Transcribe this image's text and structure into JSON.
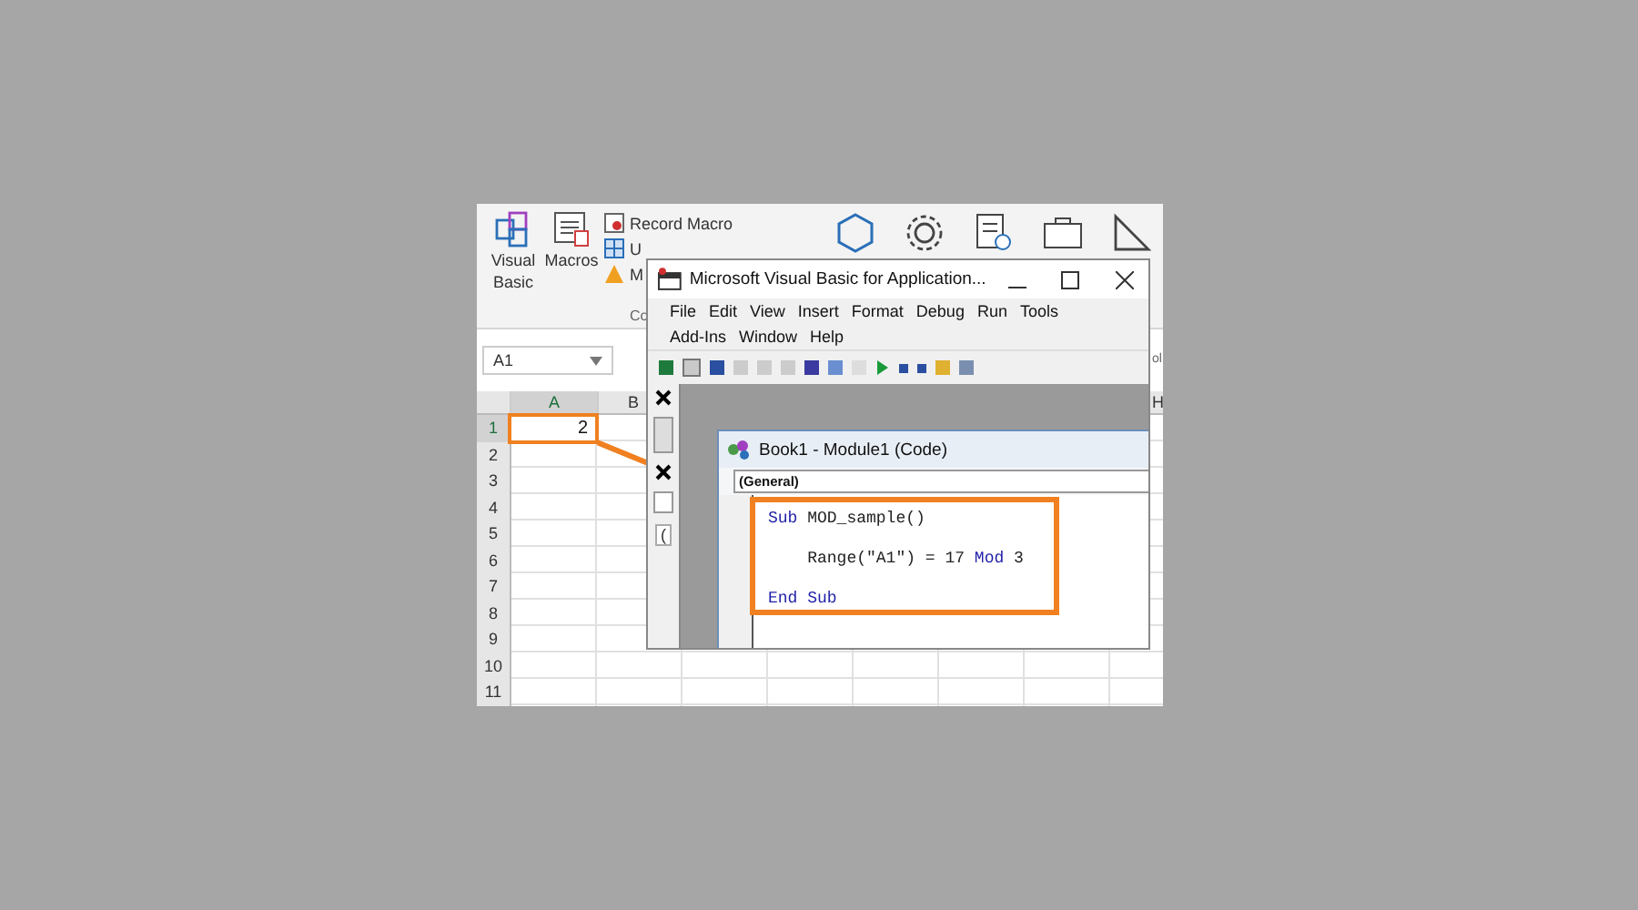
{
  "ribbon": {
    "buttons": [
      {
        "label": "Visual Basic",
        "kind": "vb"
      },
      {
        "label": "Macros",
        "kind": "macros"
      }
    ],
    "small_commands": [
      "Record Macro",
      "U",
      "M"
    ],
    "group_label": "Co",
    "right_label": "ol"
  },
  "name_box": {
    "value": "A1"
  },
  "sheet": {
    "columns": [
      "A",
      "B",
      "H"
    ],
    "rows": [
      "1",
      "2",
      "3",
      "4",
      "5",
      "6",
      "7",
      "8",
      "9",
      "10",
      "11"
    ],
    "cell_a1": "2"
  },
  "vba_window": {
    "title": "Microsoft Visual Basic for Application...",
    "menu_rows": [
      [
        "File",
        "Edit",
        "View",
        "Insert",
        "Format",
        "Debug",
        "Run",
        "Tools"
      ],
      [
        "Add-Ins",
        "Window",
        "Help"
      ]
    ],
    "side_text": "(",
    "code_window": {
      "title": "Book1 - Module1 (Code)",
      "object_combo": "(General)",
      "lines": [
        {
          "tokens": [
            {
              "text": "Sub",
              "kind": "keyword"
            },
            {
              "text": " MOD_sample()",
              "kind": "plain"
            }
          ]
        },
        {
          "tokens": [
            {
              "text": "    Range(\"A1\") = 17 ",
              "kind": "plain"
            },
            {
              "text": "Mod",
              "kind": "keyword"
            },
            {
              "text": " 3",
              "kind": "plain"
            }
          ]
        },
        {
          "tokens": [
            {
              "text": "End Sub",
              "kind": "keyword"
            }
          ]
        }
      ]
    }
  }
}
